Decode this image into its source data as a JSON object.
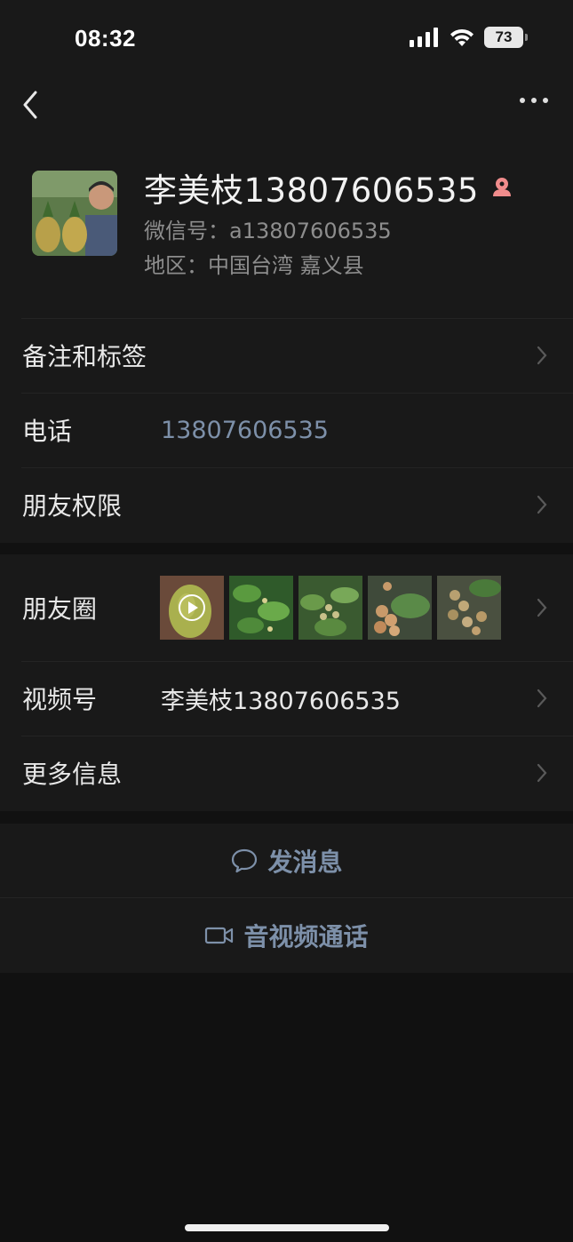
{
  "status_bar": {
    "time": "08:32",
    "battery": "73"
  },
  "profile": {
    "name": "李美枝13807606535",
    "wechat_id": "微信号：a13807606535",
    "region": "地区：中国台湾 嘉义县"
  },
  "rows": {
    "remarks_tags": "备注和标签",
    "phone_label": "电话",
    "phone_value": "13807606535",
    "friend_permissions": "朋友权限",
    "moments_label": "朋友圈",
    "channels_label": "视频号",
    "channels_value": "李美枝13807606535",
    "more_info": "更多信息"
  },
  "actions": {
    "send_message": "发消息",
    "video_call": "音视频通话"
  },
  "colors": {
    "accent_link": "#7d90a9",
    "background": "#111111",
    "surface": "#191919",
    "female_badge": "#f08c8c"
  }
}
